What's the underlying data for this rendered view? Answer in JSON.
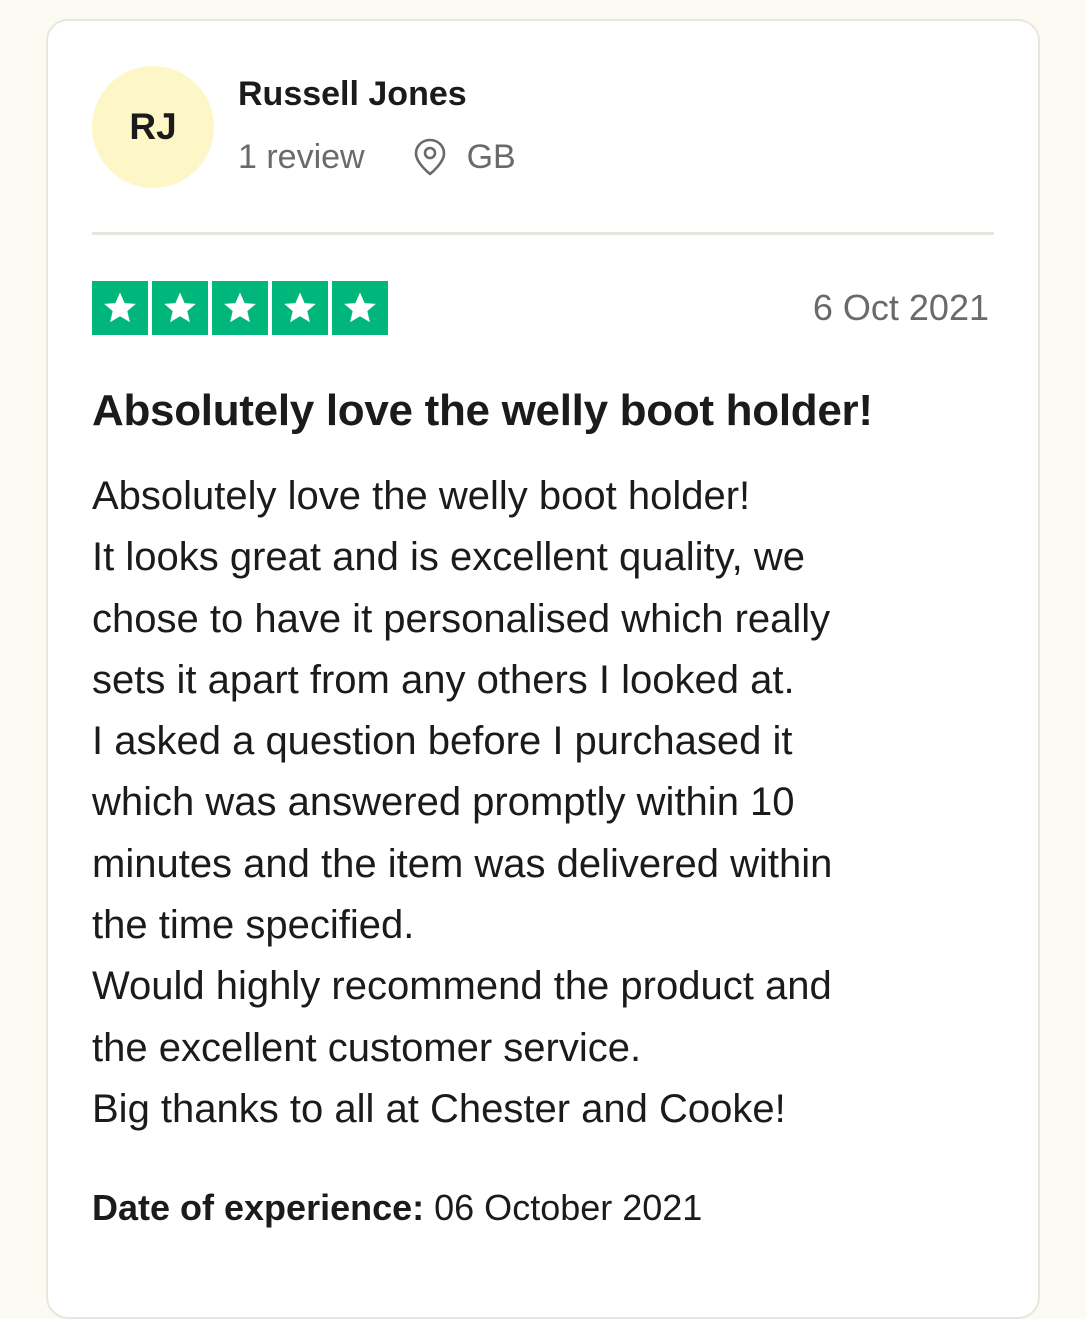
{
  "reviewer": {
    "initials": "RJ",
    "name": "Russell Jones",
    "review_count": "1 review",
    "country": "GB"
  },
  "review": {
    "rating": 5,
    "date": "6 Oct 2021",
    "title": "Absolutely love the welly boot holder!",
    "body_lines": [
      "Absolutely love the welly boot holder!",
      "It looks great and is excellent quality, we",
      "chose to have it personalised which really",
      "sets it apart from any others I looked at.",
      "I asked a question before I purchased it",
      "which was answered promptly within 10",
      "minutes and the item was delivered within",
      "the time specified.",
      "Would highly recommend the product and",
      "the excellent customer service.",
      "Big thanks to all at Chester and Cooke!"
    ],
    "experience_label": "Date of experience:",
    "experience_date": "06 October 2021"
  },
  "icons": {
    "location": "location-pin-icon",
    "star": "star-icon"
  },
  "colors": {
    "star_green": "#00b67a",
    "avatar_bg": "#fdf7c8",
    "page_bg": "#fcfbf3",
    "muted_text": "#696a6a"
  }
}
